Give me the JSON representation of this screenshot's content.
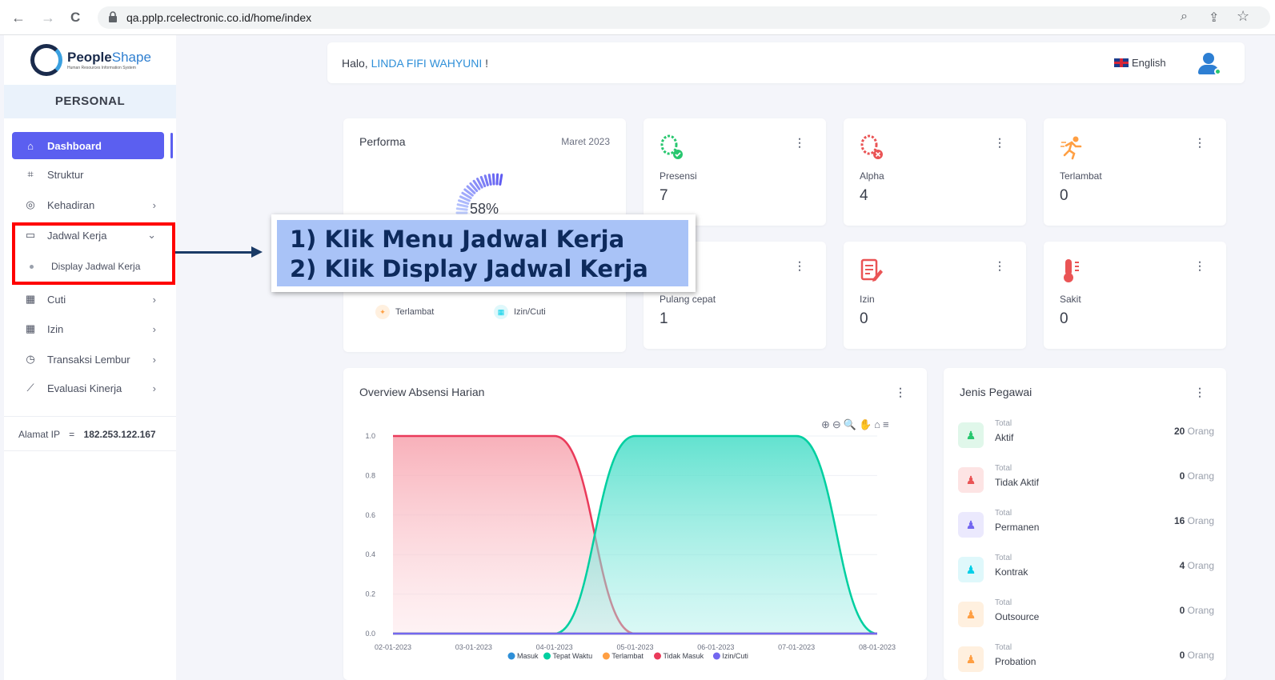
{
  "browser": {
    "url": "qa.pplp.rcelectronic.co.id/home/index",
    "back": "←",
    "forward": "→",
    "reload": "C",
    "zoom_icon": "⌕",
    "share_icon": "⇪",
    "star_icon": "☆"
  },
  "sidebar": {
    "logo_name_bold": "People",
    "logo_name_light": "Shape",
    "logo_tagline": "Human Resources Information System",
    "section": "PERSONAL",
    "items": [
      {
        "label": "Dashboard",
        "icon": "home-icon"
      },
      {
        "label": "Struktur",
        "icon": "sitemap-icon"
      },
      {
        "label": "Kehadiran",
        "icon": "fingerprint-icon"
      },
      {
        "label": "Jadwal Kerja",
        "icon": "briefcase-icon"
      },
      {
        "label": "Cuti",
        "icon": "calendar-icon"
      },
      {
        "label": "Izin",
        "icon": "calendar-icon"
      },
      {
        "label": "Transaksi Lembur",
        "icon": "clock-icon"
      },
      {
        "label": "Evaluasi Kinerja",
        "icon": "chart-line-icon"
      }
    ],
    "submenu": "Display Jadwal Kerja",
    "ip_label": "Alamat IP",
    "ip_eq": "=",
    "ip_value": "182.253.122.167"
  },
  "header": {
    "greeting": "Halo, ",
    "user": "LINDA FIFI WAHYUNI",
    "exclaim": " !",
    "language": "English"
  },
  "performa": {
    "title": "Performa",
    "period": "Maret 2023",
    "percent": "58%",
    "percent_value": 58,
    "legend": [
      "Terlambat",
      "Izin/Cuti"
    ]
  },
  "stats": [
    {
      "label": "Presensi",
      "value": "7",
      "color": "#28c76f"
    },
    {
      "label": "Alpha",
      "value": "4",
      "color": "#ea5455"
    },
    {
      "label": "Terlambat",
      "value": "0",
      "color": "#ff9f43"
    },
    {
      "label": "Pulang cepat",
      "value": "1",
      "color": "#7367f0"
    },
    {
      "label": "Izin",
      "value": "0",
      "color": "#ea5455"
    },
    {
      "label": "Sakit",
      "value": "0",
      "color": "#ea5455"
    }
  ],
  "callout": {
    "line1": "1) Klik Menu Jadwal Kerja",
    "line2": "2) Klik Display Jadwal Kerja"
  },
  "overview": {
    "title": "Overview Absensi Harian",
    "tools": "⊕⊖🔍✋⌂≡"
  },
  "chart_data": {
    "type": "area",
    "x": [
      "02-01-2023",
      "03-01-2023",
      "04-01-2023",
      "05-01-2023",
      "06-01-2023",
      "07-01-2023",
      "08-01-2023"
    ],
    "yticks": [
      "1.0",
      "0.8",
      "0.6",
      "0.4",
      "0.2",
      "0.0"
    ],
    "ylim": [
      0,
      1
    ],
    "series": [
      {
        "name": "Masuk",
        "values": [
          0,
          0,
          0,
          0,
          0,
          0,
          0
        ],
        "color": "#2e8fd8"
      },
      {
        "name": "Tepat Waktu",
        "values": [
          0,
          0,
          0,
          1,
          1,
          1,
          0
        ],
        "color": "#00cfa0"
      },
      {
        "name": "Terlambat",
        "values": [
          0,
          0,
          0,
          0,
          0,
          0,
          0
        ],
        "color": "#ff9f43"
      },
      {
        "name": "Tidak Masuk",
        "values": [
          1,
          1,
          1,
          0,
          0,
          0,
          0
        ],
        "color": "#ea3a5a"
      },
      {
        "name": "Izin/Cuti",
        "values": [
          0,
          0,
          0,
          0,
          0,
          0,
          0
        ],
        "color": "#7367f0"
      }
    ]
  },
  "jenis": {
    "title": "Jenis Pegawai",
    "total_label": "Total",
    "unit": "Orang",
    "rows": [
      {
        "name": "Aktif",
        "count": "20",
        "color": "#28c76f",
        "bg": "#e0f7ea"
      },
      {
        "name": "Tidak Aktif",
        "count": "0",
        "color": "#ea5455",
        "bg": "#fde4e4"
      },
      {
        "name": "Permanen",
        "count": "16",
        "color": "#7367f0",
        "bg": "#ebe9fd"
      },
      {
        "name": "Kontrak",
        "count": "4",
        "color": "#00cfe8",
        "bg": "#dff8fb"
      },
      {
        "name": "Outsource",
        "count": "0",
        "color": "#ff9f43",
        "bg": "#fff0df"
      },
      {
        "name": "Probation",
        "count": "0",
        "color": "#ff9f43",
        "bg": "#fff0df"
      }
    ]
  }
}
